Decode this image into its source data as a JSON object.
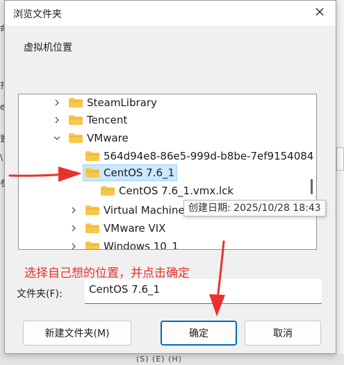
{
  "background": {
    "left_fragments": [
      "命",
      "扎",
      "er",
      "置",
      "\\",
      "参"
    ],
    "bottom_text": "  (S)   (E)   (H)"
  },
  "dialog": {
    "title": "浏览文件夹",
    "prompt": "虚拟机位置",
    "tree": [
      {
        "label": "SteamLibrary",
        "chevron": "right"
      },
      {
        "label": "Tencent",
        "chevron": "right"
      },
      {
        "label": "VMware",
        "chevron": "down"
      },
      {
        "label": "564d94e8-86e5-999d-b8be-7ef9154084",
        "chevron": "none"
      },
      {
        "label": "CentOS 7.6_1",
        "chevron": "down",
        "selected": true
      },
      {
        "label": "CentOS 7.6_1.vmx.lck",
        "chevron": "none"
      },
      {
        "label": "Virtual Machine",
        "chevron": "right"
      },
      {
        "label": "VMware VIX",
        "chevron": "right"
      },
      {
        "label": "Windows 10_1",
        "chevron": "right"
      }
    ],
    "tooltip": "创建日期: 2025/10/28 18:43",
    "annotation": "选择自己想的位置，并点击确定",
    "folder_label": "文件夹(F):",
    "folder_value": "CentOS 7.6_1",
    "buttons": {
      "new_folder": "新建文件夹(M)",
      "ok": "确定",
      "cancel": "取消"
    }
  },
  "colors": {
    "folder": "#f8c84a",
    "selection": "#cce8ff",
    "annotation": "#e8322e",
    "ok_border": "#0067c0"
  },
  "icons": [
    "close-icon",
    "chevron-right-icon",
    "chevron-down-icon",
    "folder-icon"
  ]
}
